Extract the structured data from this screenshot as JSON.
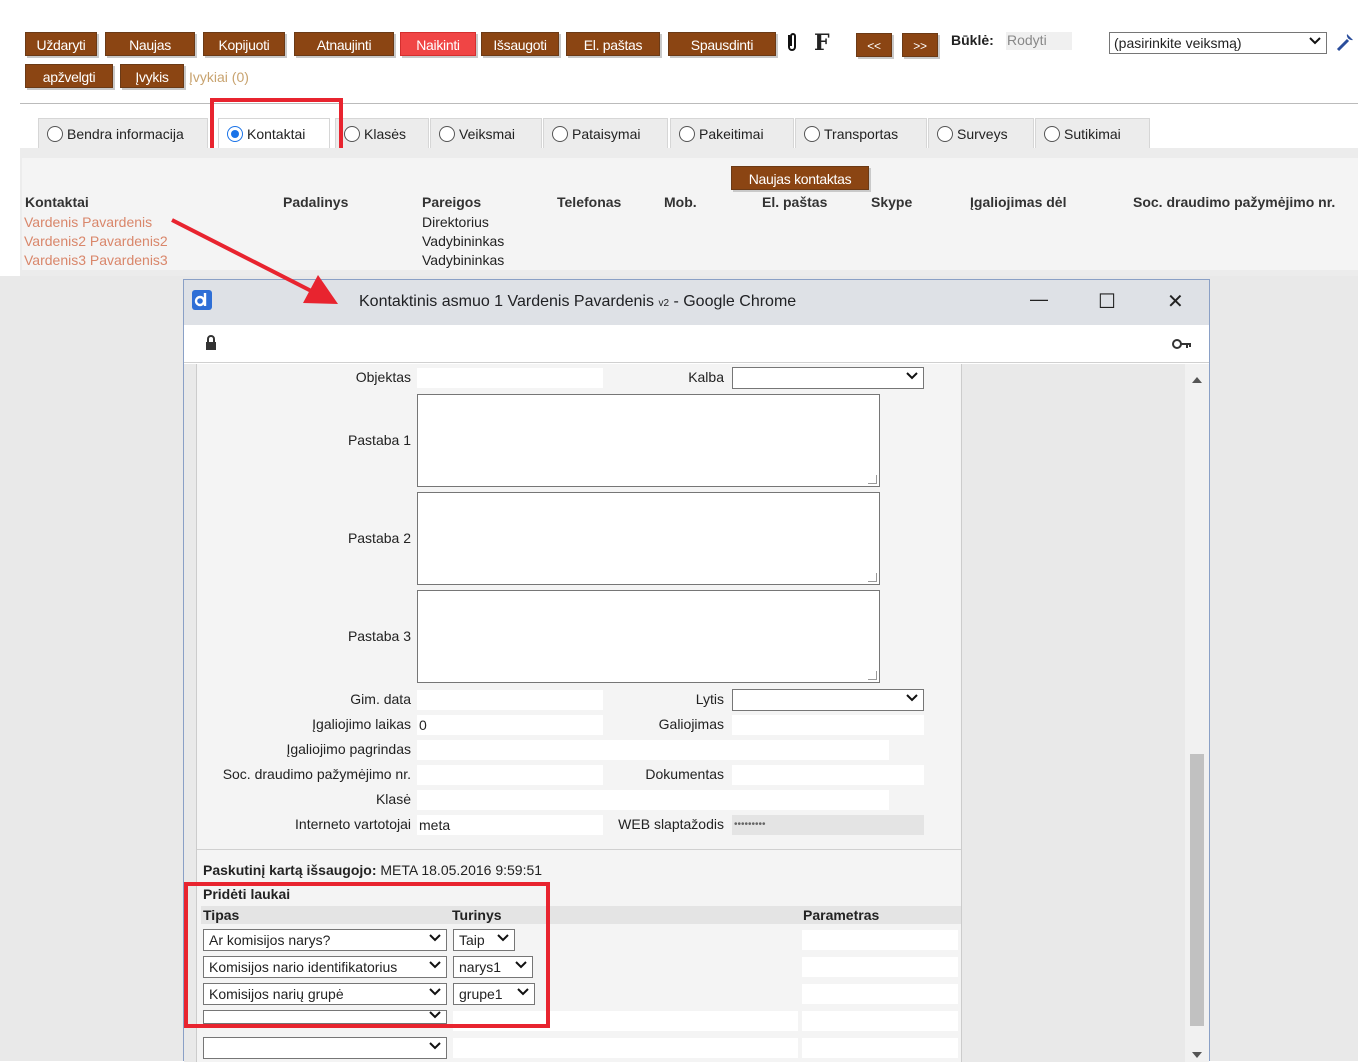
{
  "toolbar": {
    "buttons": [
      "Uždaryti",
      "Naujas",
      "Kopijuoti",
      "Atnaujinti",
      "Naikinti",
      "Išsaugoti",
      "El. paštas",
      "Spausdinti"
    ],
    "attach": "0",
    "f": "F",
    "prev": "<<",
    "next": ">>",
    "status_label": "Būklė:",
    "status_value": "Rodyti",
    "action_select": "(pasirinkite veiksmą)",
    "row2_buttons": [
      "apžvelgti",
      "Įvykis"
    ],
    "events_link": "Įvykiai (0)"
  },
  "tabs": [
    "Bendra informacija",
    "Kontaktai",
    "Klasės",
    "Veiksmai",
    "Pataisymai",
    "Pakeitimai",
    "Transportas",
    "Surveys",
    "Sutikimai"
  ],
  "contacts": {
    "new_button": "Naujas kontaktas",
    "columns": [
      "Kontaktai",
      "Padalinys",
      "Pareigos",
      "Telefonas",
      "Mob.",
      "El. paštas",
      "Skype",
      "Įgaliojimas dėl",
      "Soc. draudimo pažymėjimo nr."
    ],
    "rows": [
      {
        "name": "Vardenis Pavardenis",
        "role": "Direktorius"
      },
      {
        "name": "Vardenis2 Pavardenis2",
        "role": "Vadybininkas"
      },
      {
        "name": "Vardenis3 Pavardenis3",
        "role": "Vadybininkas"
      }
    ]
  },
  "popup": {
    "title": "Kontaktinis asmuo 1 Vardenis Pavardenis",
    "title_sub": "v2",
    "title_suffix": " - Google Chrome",
    "controls": {
      "min": "—",
      "max": "☐",
      "close": "✕"
    },
    "fields": {
      "objektas": "Objektas",
      "kalba": "Kalba",
      "pastaba1": "Pastaba 1",
      "pastaba2": "Pastaba 2",
      "pastaba3": "Pastaba 3",
      "gim_data": "Gim. data",
      "lytis": "Lytis",
      "igaliojimo_laikas": "Įgaliojimo laikas",
      "igaliojimo_laikas_value": "0",
      "galiojimas": "Galiojimas",
      "igaliojimo_pagrindas": "Įgaliojimo pagrindas",
      "soc_nr": "Soc. draudimo pažymėjimo nr.",
      "dokumentas": "Dokumentas",
      "klase": "Klasė",
      "interneto_vartotojai": "Interneto vartotojai",
      "interneto_vartotojai_value": "meta",
      "web_slaptazodis": "WEB slaptažodis",
      "web_slaptazodis_value": "•••••••••"
    },
    "saved_label": "Paskutinį kartą išsaugojo:",
    "saved_value": "META 18.05.2016 9:59:51",
    "added_fields_title": "Pridėti laukai",
    "added_columns": [
      "Tipas",
      "Turinys",
      "Parametras"
    ],
    "added_rows": [
      {
        "tipas": "Ar komisijos narys?",
        "turinys": "Taip"
      },
      {
        "tipas": "Komisijos nario identifikatorius",
        "turinys": "narys1"
      },
      {
        "tipas": "Komisijos narių grupė",
        "turinys": "grupe1"
      },
      {
        "tipas": "",
        "turinys": ""
      },
      {
        "tipas": "",
        "turinys": ""
      }
    ]
  }
}
